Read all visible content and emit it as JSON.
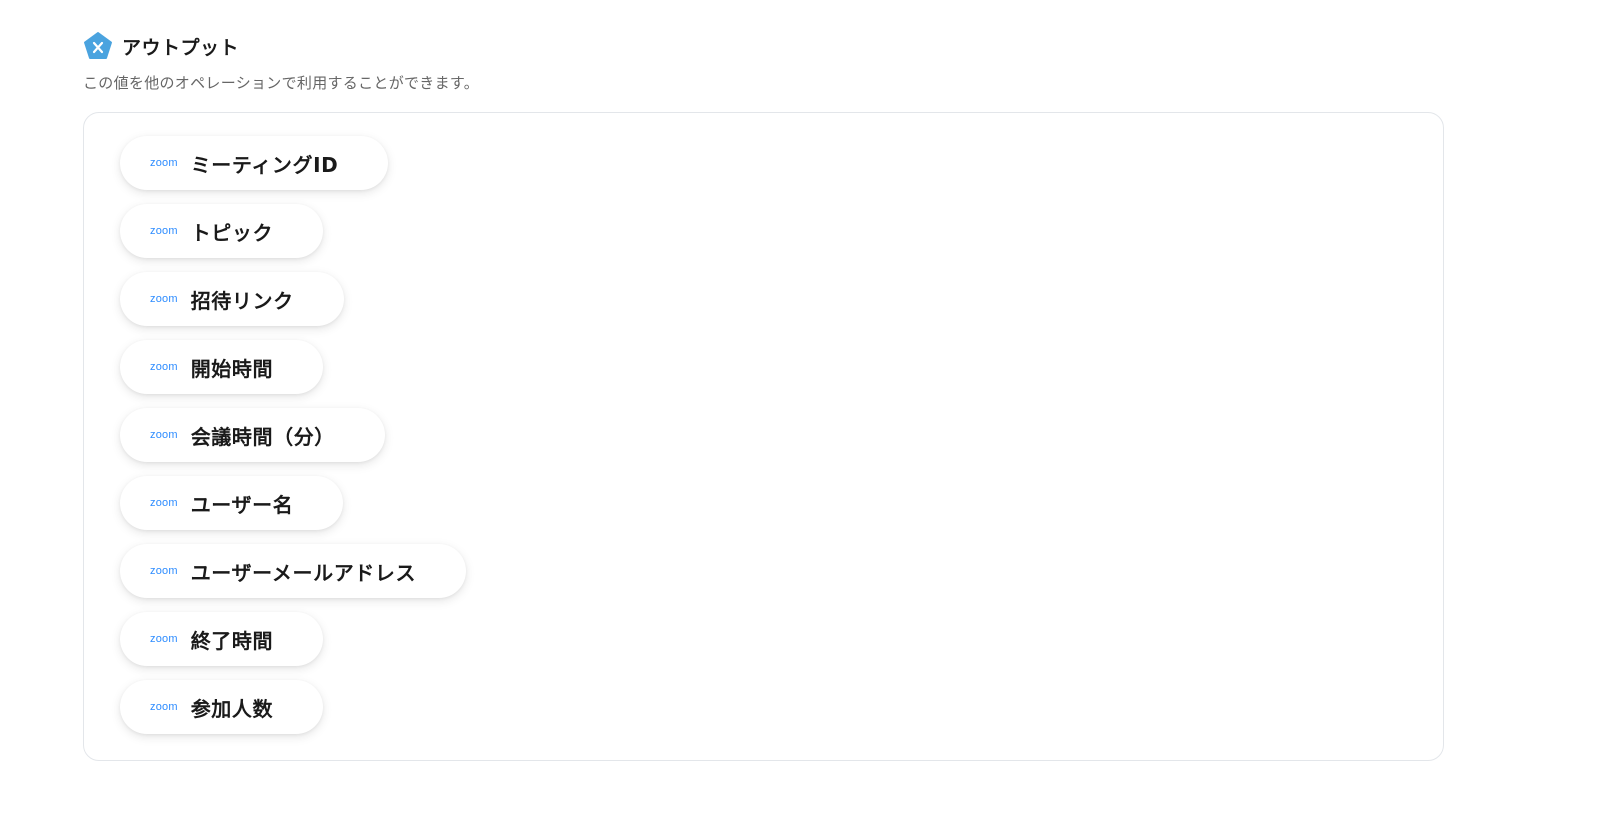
{
  "header": {
    "title": "アウトプット",
    "icon": "yoom-pentagon-icon",
    "icon_color": "#4aa3df"
  },
  "description": "この値を他のオペレーションで利用することができます。",
  "outputs": [
    {
      "logo": "zoom",
      "label": "ミーティングID"
    },
    {
      "logo": "zoom",
      "label": "トピック"
    },
    {
      "logo": "zoom",
      "label": "招待リンク"
    },
    {
      "logo": "zoom",
      "label": "開始時間"
    },
    {
      "logo": "zoom",
      "label": "会議時間（分）"
    },
    {
      "logo": "zoom",
      "label": "ユーザー名"
    },
    {
      "logo": "zoom",
      "label": "ユーザーメールアドレス"
    },
    {
      "logo": "zoom",
      "label": "終了時間"
    },
    {
      "logo": "zoom",
      "label": "参加人数"
    }
  ],
  "colors": {
    "zoom_brand": "#2d8cff",
    "border": "#e3e6ea"
  }
}
